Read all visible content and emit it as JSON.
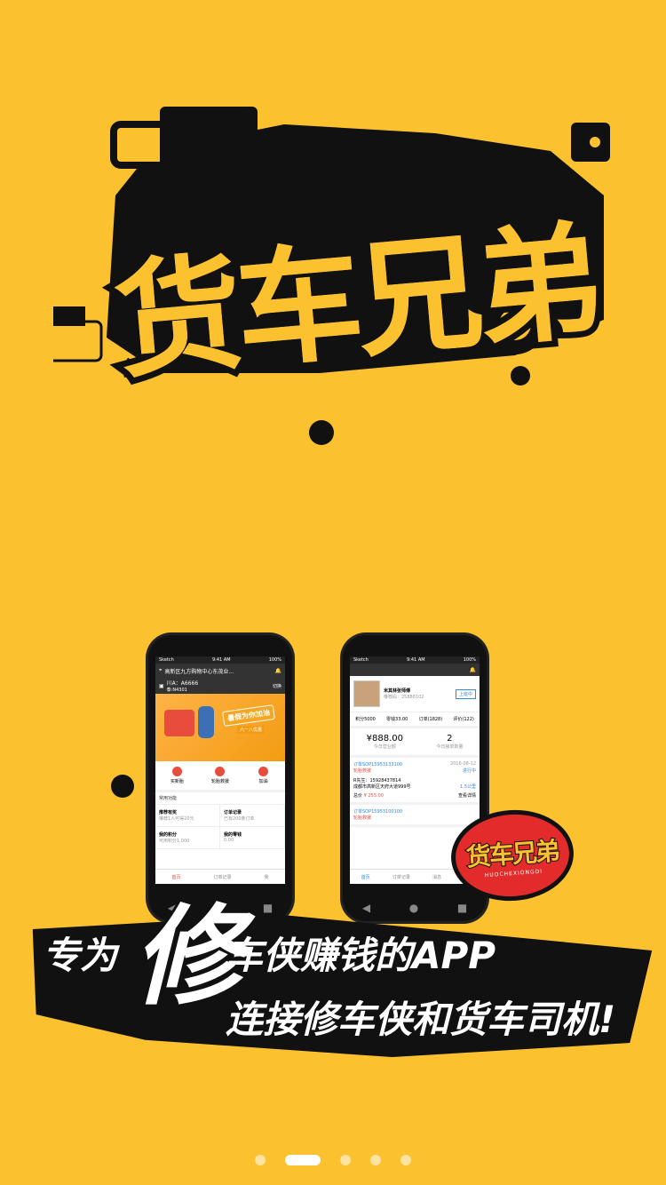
{
  "colors": {
    "bg": "#fcc12f",
    "dark": "#111111",
    "accent": "#e32b2b",
    "blue": "#2b8be6"
  },
  "logo": {
    "title": "货车兄弟"
  },
  "phone_left": {
    "status_time": "9:41 AM",
    "status_carrier": "Sketch",
    "status_battery": "100%",
    "location": "高新区九方购物中心东茂业...",
    "plate": "川A：A6666",
    "plate_sub": "泰:N4301",
    "switch": "切换",
    "banner_title": "暑假为你加油",
    "banner_sub": "六一八优惠",
    "icons": [
      {
        "label": "买新胎",
        "color": "#e74c3c"
      },
      {
        "label": "轮胎救援",
        "color": "#e74c3c"
      },
      {
        "label": "加油",
        "color": "#e74c3c"
      }
    ],
    "section": "常用功能",
    "grid": [
      {
        "t": "推荐有奖",
        "s": "推荐1人可得20元"
      },
      {
        "t": "订单记录",
        "s": "已有200条订单"
      },
      {
        "t": "我的积分",
        "s": "可用积分1,000"
      },
      {
        "t": "我的零钱",
        "s": "0.00"
      }
    ],
    "tabs": [
      "首页",
      "订单记录",
      "我"
    ]
  },
  "phone_right": {
    "status_time": "9:41 AM",
    "status_carrier": "Sketch",
    "status_battery": "100%",
    "name": "米其林张师傅",
    "phone": "推荐码：25888102",
    "online": "上班中",
    "stats": [
      "积分5000",
      "零钱33.00",
      "订单(1828)",
      "评价(122)"
    ],
    "money": "¥888.00",
    "money_label": "今日营业额",
    "count": "2",
    "count_label": "今日接单数量",
    "orders": [
      {
        "no": "订单SOP15953133100",
        "date": "2016-08-12",
        "status": "进行中",
        "tag": "轮胎救援",
        "contact": "R先生：15928437814",
        "addr": "成都市高新区天府大道999号",
        "dist": "1.5公里",
        "price_label": "总价",
        "price": "¥ 255.00",
        "detail": "查看详情"
      },
      {
        "no": "订单SOP15953100100",
        "tag": "轮胎救援"
      }
    ],
    "tabs": [
      "首页",
      "订单记录",
      "消息",
      "我"
    ]
  },
  "stamp": {
    "title": "货车兄弟",
    "sub": "HUOCHEXIONGDI"
  },
  "slogan": {
    "line1_a": "专为",
    "big": "修",
    "line1_b": "车侠赚钱的APP",
    "line2": "连接修车侠和货车司机!"
  },
  "pager": {
    "count": 5,
    "active": 1
  }
}
